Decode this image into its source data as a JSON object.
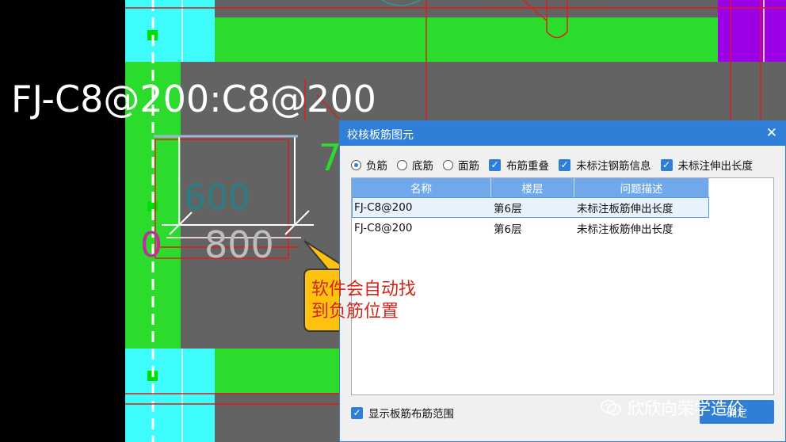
{
  "cad": {
    "main_label": "FJ-C8@200:C8@200",
    "dim_600": "600",
    "dim_800": "800",
    "dim_7": "7",
    "dim_0": "0"
  },
  "dialog": {
    "title": "校核板筋图元",
    "close_icon": "close-icon",
    "filters": {
      "radios": [
        {
          "label": "负筋",
          "selected": true
        },
        {
          "label": "底筋",
          "selected": false
        },
        {
          "label": "面筋",
          "selected": false
        }
      ],
      "checkboxes": [
        {
          "label": "布筋重叠",
          "checked": true
        },
        {
          "label": "未标注钢筋信息",
          "checked": true
        },
        {
          "label": "未标注伸出长度",
          "checked": true
        }
      ]
    },
    "table": {
      "columns": [
        "名称",
        "楼层",
        "问题描述"
      ],
      "rows": [
        [
          "FJ-C8@200",
          "第6层",
          "未标注板筋伸出长度"
        ],
        [
          "FJ-C8@200",
          "第6层",
          "未标注板筋伸出长度"
        ]
      ],
      "selected_row": 0
    },
    "footer_checkbox": {
      "label": "显示板筋布筋范围",
      "checked": true
    },
    "ok_button": "确定"
  },
  "callout": {
    "line1": "软件会自动找",
    "line2": "到负筋位置"
  },
  "watermark": "欣欣向荣学造价",
  "colors": {
    "cad_green": "#2cdc2c",
    "cad_cyan": "#3ffcfc",
    "cad_purple": "#9b00e6",
    "cad_red": "#e01a1a",
    "cad_gray": "#636363",
    "dialog_blue": "#2f7fd8",
    "callout_fill": "#ffc20e"
  }
}
